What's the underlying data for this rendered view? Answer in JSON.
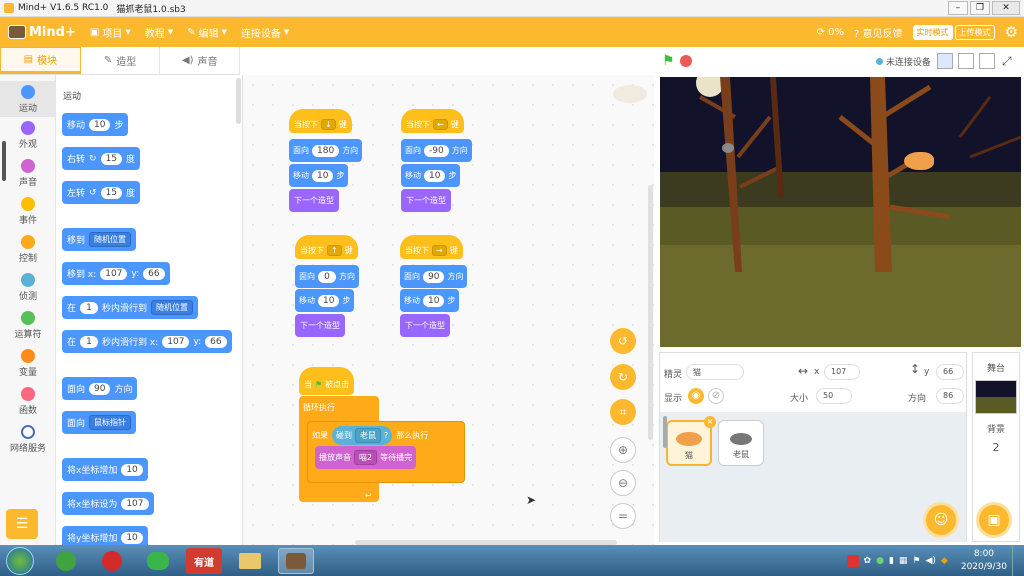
{
  "window": {
    "title": "Mind+ V1.6.5 RC1.0",
    "file": "猫抓老鼠1.0.sb3",
    "controls": [
      "–",
      "❐",
      "✕"
    ]
  },
  "menubar": {
    "logo": "Mind+",
    "items": [
      {
        "label": "项目"
      },
      {
        "label": "教程"
      },
      {
        "label": "编辑"
      },
      {
        "label": "连接设备"
      }
    ],
    "progress": "0%",
    "feedback": "意见反馈",
    "mode_realtime": "实时模式",
    "mode_upload": "上传模式"
  },
  "tabs": [
    {
      "label": "模块"
    },
    {
      "label": "造型"
    },
    {
      "label": "声音"
    }
  ],
  "categories": [
    {
      "label": "运动",
      "color": "#4c97ff"
    },
    {
      "label": "外观",
      "color": "#9966ff"
    },
    {
      "label": "声音",
      "color": "#cf63cf"
    },
    {
      "label": "事件",
      "color": "#ffbf00"
    },
    {
      "label": "控制",
      "color": "#ffab19"
    },
    {
      "label": "侦测",
      "color": "#5cb1d6"
    },
    {
      "label": "运算符",
      "color": "#59c059"
    },
    {
      "label": "变量",
      "color": "#ff8c1a"
    },
    {
      "label": "函数",
      "color": "#ff6680"
    },
    {
      "label": "网络服务",
      "color": "#4b6fb5"
    }
  ],
  "palette": {
    "title": "运动",
    "move": {
      "label": "移动",
      "value": "10",
      "unit": "步"
    },
    "turn_right": {
      "label": "右转",
      "value": "15",
      "unit": "度"
    },
    "turn_left": {
      "label": "左转",
      "value": "15",
      "unit": "度"
    },
    "goto": {
      "label": "移到",
      "option": "随机位置"
    },
    "goto_xy": {
      "label": "移到 x:",
      "x": "107",
      "ylabel": "y:",
      "y": "66"
    },
    "glide": {
      "pre": "在",
      "secs": "1",
      "mid": "秒内滑行到",
      "option": "随机位置"
    },
    "glide_xy": {
      "pre": "在",
      "secs": "1",
      "mid": "秒内滑行到 x:",
      "x": "107",
      "ylabel": "y:",
      "y": "66"
    },
    "point_dir": {
      "label": "面向",
      "value": "90",
      "unit": "方向"
    },
    "point_to": {
      "label": "面向",
      "option": "鼠标指针"
    },
    "change_x": {
      "label": "将x坐标增加",
      "value": "10"
    },
    "set_x": {
      "label": "将x坐标设为",
      "value": "107"
    },
    "change_y": {
      "label": "将y坐标增加",
      "value": "10"
    }
  },
  "scripts": {
    "when_key": "当按下",
    "key_suffix": "键",
    "point": "面向",
    "direction": "方向",
    "move": "移动",
    "steps": "步",
    "next_costume": "下一个造型",
    "s1": {
      "key": "↓",
      "dir": "180",
      "steps": "10"
    },
    "s2": {
      "key": "←",
      "dir": "-90",
      "steps": "10"
    },
    "s3": {
      "key": "↑",
      "dir": "0",
      "steps": "10"
    },
    "s4": {
      "key": "→",
      "dir": "90",
      "steps": "10"
    },
    "flag_pre": "当",
    "flag_post": "被点击",
    "forever": "循环执行",
    "if": "如果",
    "touching": "碰到",
    "target": "老鼠",
    "q": "?",
    "then": "那么执行",
    "play": "播放声音",
    "sound": "喵2",
    "until_done": "等待播完"
  },
  "stage": {
    "status": "未连接设备"
  },
  "sprite": {
    "label": "精灵",
    "name": "猫",
    "x_label": "x",
    "x": "107",
    "y_label": "y",
    "y": "66",
    "show_label": "显示",
    "size_label": "大小",
    "size": "50",
    "dir_label": "方向",
    "dir": "86"
  },
  "sprites": [
    {
      "name": "猫"
    },
    {
      "name": "老鼠"
    }
  ],
  "backdrop": {
    "label": "舞台",
    "bg_label": "背景",
    "count": "2"
  },
  "taskbar": {
    "time": "8:00",
    "date": "2020/9/30",
    "app": "有道"
  }
}
